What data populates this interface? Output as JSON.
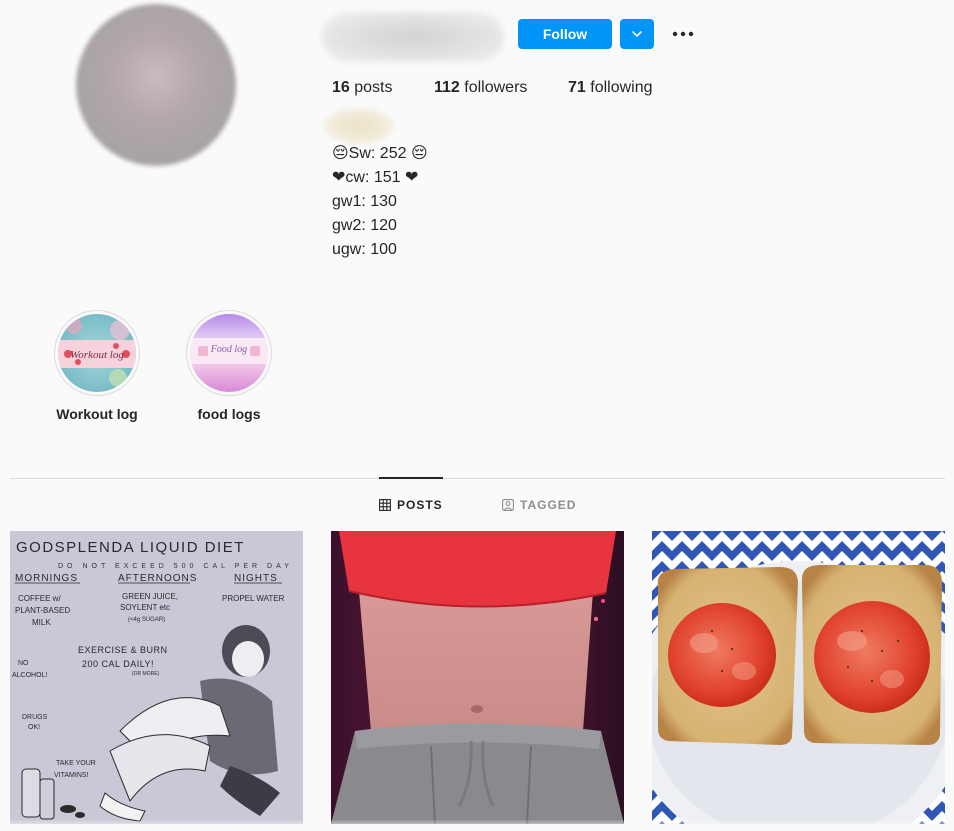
{
  "profile": {
    "follow_label": "Follow",
    "stats": {
      "posts_count": "16",
      "posts_label": " posts",
      "followers_count": "112",
      "followers_label": " followers",
      "following_count": "71",
      "following_label": " following"
    },
    "bio": [
      "😔Sw: 252 😔",
      "❤cw: 151 ❤",
      "gw1: 130",
      "gw2: 120",
      "ugw: 100"
    ]
  },
  "highlights": [
    {
      "label": "Workout log",
      "cover_text": "Workout log"
    },
    {
      "label": "food logs",
      "cover_text": "Food log"
    }
  ],
  "tabs": [
    {
      "label": "POSTS",
      "icon": "grid-icon",
      "active": true
    },
    {
      "label": "TAGGED",
      "icon": "tag-icon",
      "active": false
    }
  ],
  "posts": [
    {
      "description": "hand-drawn illustration poster",
      "lines": {
        "title": "GODSPLENDA LIQUID DIET",
        "subtitle": "DO NOT EXCEED 500 CAL PER DAY",
        "mornings": "MORNINGS",
        "afternoons": "AFTERNOONS",
        "nights": "NIGHTS",
        "coffee": "COFFEE w/",
        "plant": "PLANT-BASED",
        "milk": "MILK",
        "green": "GREEN JUICE,",
        "soylent": "SOYLENT etc",
        "sugar": "(<4g SUGAR)",
        "propel": "PROPEL WATER",
        "exercise": "EXERCISE & BURN",
        "burn": "200 CAL DAILY!",
        "more": "(OR MORE)",
        "no": "NO",
        "alcohol": "ALCOHOL!",
        "drugs": "DRUGS",
        "ok": "OK!",
        "take": "TAKE YOUR",
        "vitamins": "VITAMINS!"
      }
    },
    {
      "description": "photo of torso in red top and grey sweatpants"
    },
    {
      "description": "photo of toast with tomato slices on a plate"
    }
  ],
  "colors": {
    "accent": "#0095f6",
    "text": "#262626",
    "muted": "#8e8e8e",
    "background": "#fafafa",
    "divider": "#dbdbdb"
  }
}
